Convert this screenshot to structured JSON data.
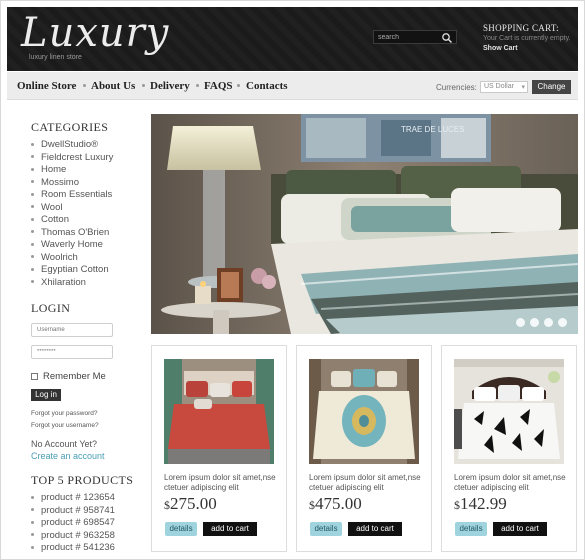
{
  "header": {
    "logo": "Luxury",
    "tagline": "luxury linen store",
    "search_placeholder": "search",
    "cart_title": "SHOPPING CART:",
    "cart_status": "Your Cart is currently empty.",
    "cart_link": "Show Cart"
  },
  "nav": {
    "items": [
      "Online Store",
      "About Us",
      "Delivery",
      "FAQS",
      "Contacts"
    ],
    "currencies_label": "Currencies:",
    "currency_value": "US Dollar",
    "change_label": "Change"
  },
  "sidebar": {
    "categories_heading": "CATEGORIES",
    "categories": [
      "DwellStudio®",
      "Fieldcrest Luxury",
      "Home",
      "Mossimo",
      "Room Essentials",
      "Wool",
      "Cotton",
      "Thomas O'Brien",
      "Waverly Home",
      "Woolrich",
      "Egyptian Cotton",
      "Xhilaration"
    ],
    "login_heading": "LOGIN",
    "username_placeholder": "Username",
    "password_placeholder": "********",
    "remember_label": "Remember Me",
    "login_button": "Log in",
    "forgot_password": "Forgot your password?",
    "forgot_username": "Forgot your username?",
    "no_account": "No Account Yet?",
    "create_account": "Create an account",
    "top_products_heading": "TOP 5 PRODUCTS",
    "top_products": [
      "product # 123654",
      "product # 958741",
      "product # 698547",
      "product # 963258",
      "product # 541236"
    ]
  },
  "hero": {
    "art_text": "TRAE DE LUCES"
  },
  "products": [
    {
      "desc": "Lorem ipsum dolor sit amet,nse ctetuer adipiscing elit",
      "currency": "$",
      "price": "275.00",
      "details": "details",
      "add": "add to cart"
    },
    {
      "desc": "Lorem ipsum dolor sit amet,nse ctetuer adipiscing elit",
      "currency": "$",
      "price": "475.00",
      "details": "details",
      "add": "add to cart"
    },
    {
      "desc": "Lorem ipsum dolor sit amet,nse ctetuer adipiscing elit",
      "currency": "$",
      "price": "142.99",
      "details": "details",
      "add": "add to cart"
    }
  ],
  "colors": {
    "header_bg": "#1e1e1e",
    "nav_bg": "#ececec",
    "accent_link": "#4a9eb5",
    "details_button": "#9fd4de",
    "cart_button": "#111111"
  }
}
